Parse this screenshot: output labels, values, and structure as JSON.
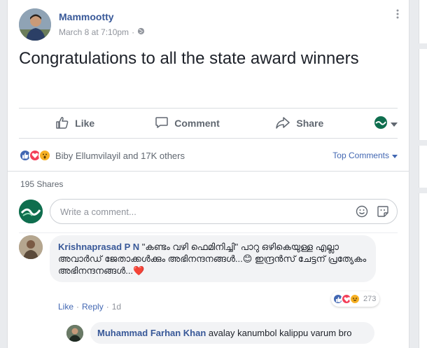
{
  "post": {
    "author": "Mammootty",
    "date": "March 8 at 7:10pm",
    "separator": "·",
    "privacy_icon": "globe-icon",
    "more_icon": "more-dots-icon",
    "text": "Congratulations to all the state award winners"
  },
  "actions": {
    "like": "Like",
    "comment": "Comment",
    "share": "Share"
  },
  "reactions": {
    "types": [
      "like",
      "love",
      "wow"
    ],
    "summary": "Biby Ellumvilayil and 17K others",
    "top_comments": "Top Comments"
  },
  "shares": "195 Shares",
  "composer": {
    "placeholder": "Write a comment..."
  },
  "comment": {
    "author": "Krishnaprasad P N",
    "text": "\"കണ്ടം വഴി ഫെമിനിച്ചി\" പാറു ഒഴികെയുള്ള എല്ലാ അവാർഡ് ജേതാക്കൾക്കും അഭിനന്ദനങ്ങൾ...😊 ഇന്ദ്രൻസ് ചേട്ടന് പ്രത്യേകം അഭിനന്ദനങ്ങൾ...❤️",
    "like": "Like",
    "reply": "Reply",
    "separator": "·",
    "time": "1d",
    "reaction_count": "273"
  },
  "reply": {
    "author": "Muhammad Farhan Khan",
    "text": "avalay kanumbol kalippu varum bro"
  },
  "colors": {
    "link": "#385898",
    "like_blue": "#4267b2",
    "love_red": "#f33e58",
    "wow_yellow": "#f7b125"
  }
}
